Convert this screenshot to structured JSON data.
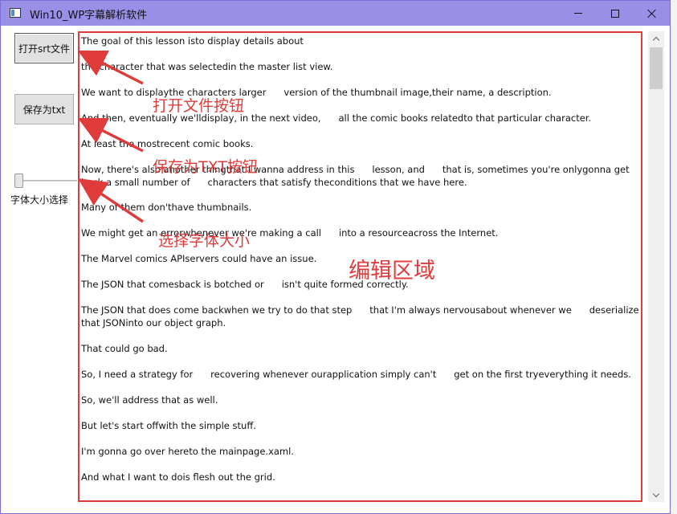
{
  "window": {
    "title": "Win10_WP字幕解析软件",
    "controls": {
      "minimize": "minimize",
      "maximize": "maximize",
      "close": "close"
    }
  },
  "sidebar": {
    "open_button": "打开srt文件",
    "save_button": "保存为txt",
    "font_size_label": "字体大小选择",
    "font_size_value": 0
  },
  "editor": {
    "lines": [
      "The goal of this lesson isto display details about",
      "the character that was selectedin the master list view.",
      "We want to displaythe characters larger      version of the thumbnail image,their name, a description.",
      "And then, eventually we'lldisplay, in the next video,      all the comic books relatedto that particular character.",
      "At least the mostrecent comic books.",
      "Now, there's also another thingthat I wanna address in this      lesson, and      that is, sometimes you're onlygonna get back a small number of      characters that satisfy theconditions that we have here.",
      "Many of them don'thave thumbnails.",
      "We might get an errorwhenever we're making a call      into a resourceacross the Internet.",
      "The Marvel comics APIservers could have an issue.",
      "The JSON that comesback is botched or      isn't quite formed correctly.",
      "The JSON that does come backwhen we try to do that step      that I'm always nervousabout whenever we      deserialize that JSONinto our object graph.",
      "That could go bad.",
      "So, I need a strategy for      recovering whenever ourapplication simply can't      get on the first tryeverything it needs.",
      "So, we'll address that as well.",
      "But let's start offwith the simple stuff.",
      "I'm gonna go over hereto the mainpage.xaml.",
      "And what I want to dois flesh out the grid."
    ]
  },
  "annotations": {
    "open_button": "打开文件按钮",
    "save_button": "保存为TXT按钮",
    "font_size": "选择字体大小",
    "edit_area": "编辑区域",
    "color": "#e03b3b"
  }
}
